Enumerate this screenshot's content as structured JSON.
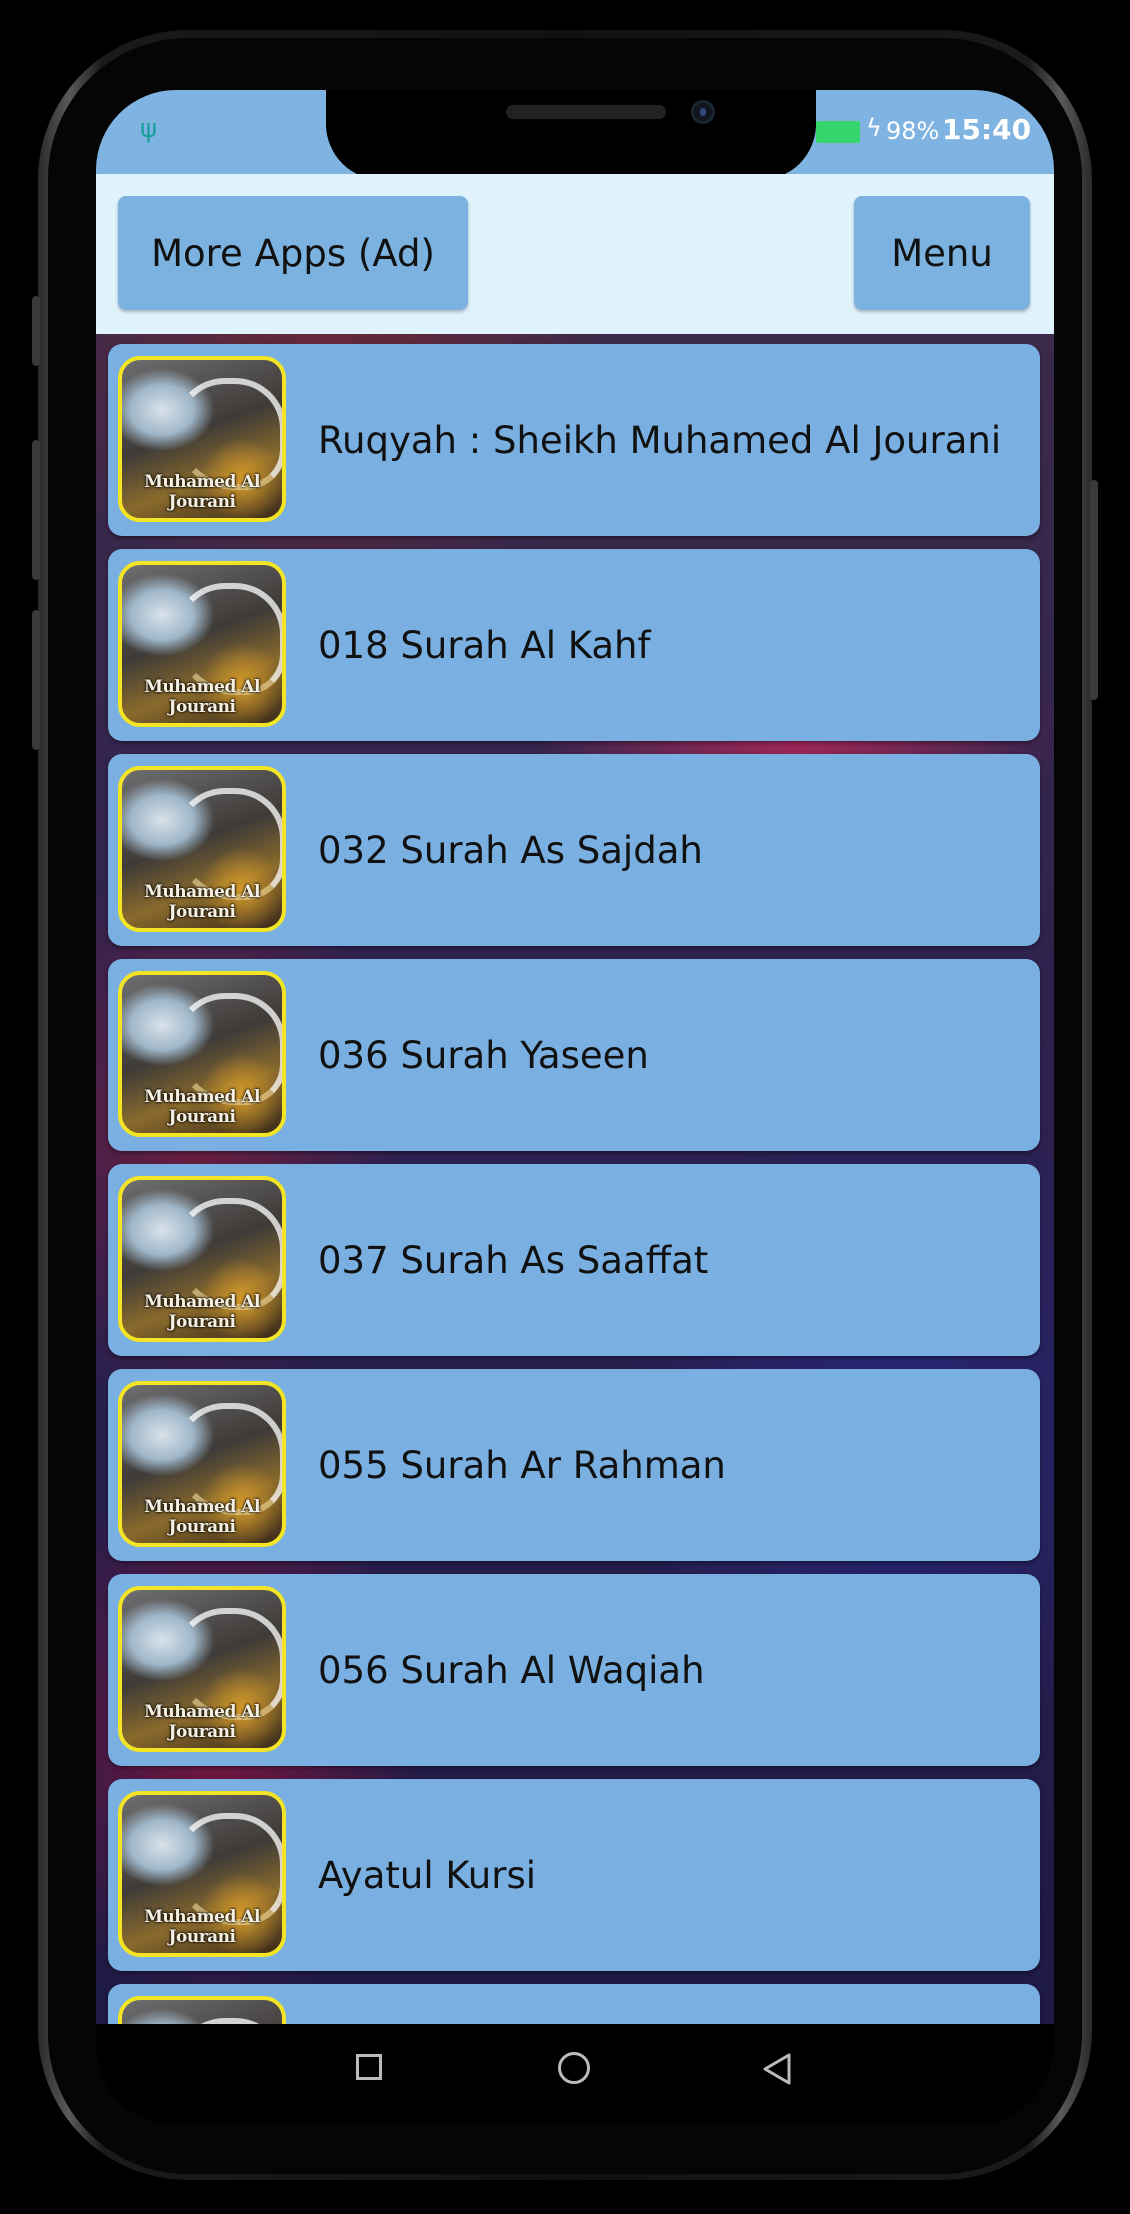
{
  "status_bar": {
    "usb_icon": "usb-icon",
    "battery_percent": "98%",
    "time": "15:40"
  },
  "toolbar": {
    "more_apps_label": "More Apps (Ad)",
    "menu_label": "Menu"
  },
  "thumbnail_caption": "Muhamed Al Jourani",
  "list": [
    {
      "label": "Ruqyah : Sheikh Muhamed Al Jourani"
    },
    {
      "label": "018 Surah Al Kahf"
    },
    {
      "label": "032 Surah As Sajdah"
    },
    {
      "label": "036 Surah Yaseen"
    },
    {
      "label": "037 Surah As Saaffat"
    },
    {
      "label": "055 Surah Ar Rahman"
    },
    {
      "label": "056 Surah Al Waqiah"
    },
    {
      "label": "Ayatul Kursi"
    }
  ],
  "colors": {
    "status_bar": "#7fb3e2",
    "toolbar_bg": "#e0f2fc",
    "button": "#7cb2e0",
    "list_item": "#7ab0e1",
    "thumb_border": "#f3e425",
    "battery": "#36d66f"
  }
}
